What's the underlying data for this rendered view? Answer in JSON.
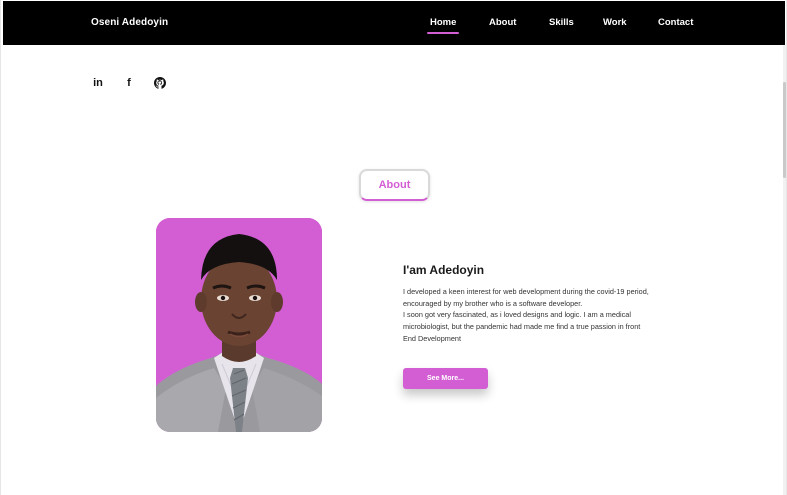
{
  "header": {
    "brand": "Oseni Adedoyin",
    "nav": [
      {
        "label": "Home",
        "active": true
      },
      {
        "label": "About",
        "active": false
      },
      {
        "label": "Skills",
        "active": false
      },
      {
        "label": "Work",
        "active": false
      },
      {
        "label": "Contact",
        "active": false
      }
    ]
  },
  "social": {
    "icons": [
      "linkedin-icon",
      "facebook-icon",
      "github-icon"
    ],
    "linkedin_text": "in",
    "facebook_text": "f"
  },
  "about": {
    "section_label": "About",
    "heading": "I'am Adedoyin",
    "paragraph_lines": [
      "I developed a keen interest for web development during the covid-19 period,",
      "encouraged by my brother who is a software developer.",
      "I soon got very fascinated, as i loved designs and logic. I am a medical",
      "microbiologist, but the pandemic had made me find a true passion in front",
      "End Development"
    ],
    "button_label": "See More..."
  },
  "colors": {
    "accent": "#d35ed4",
    "navbar": "#000000",
    "background": "#ffffff"
  }
}
